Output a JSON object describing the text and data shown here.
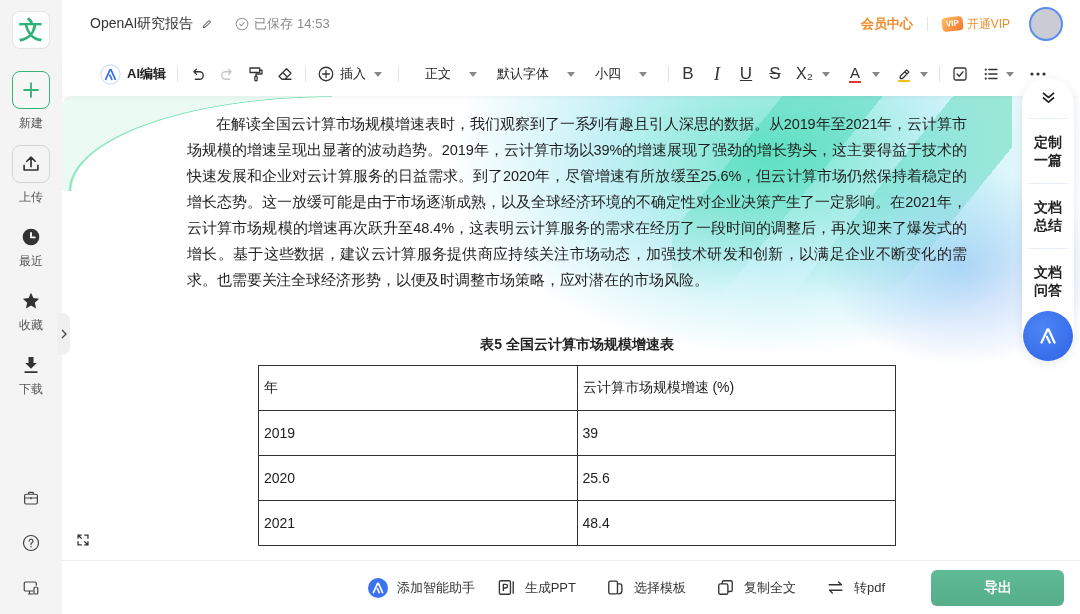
{
  "sidebar": {
    "logo": "文",
    "items": [
      {
        "label": "新建",
        "kind": "primary"
      },
      {
        "label": "上传",
        "kind": "tile"
      },
      {
        "label": "最近",
        "kind": "plain"
      },
      {
        "label": "收藏",
        "kind": "plain"
      },
      {
        "label": "下载",
        "kind": "plain"
      }
    ]
  },
  "header": {
    "title": "OpenAI研究报告",
    "save_status": "已保存 14:53",
    "member_center": "会员中心",
    "vip_badge": "VIP",
    "vip_label": "开通VIP"
  },
  "toolbar": {
    "ai_edit": "AI编辑",
    "history": [
      {
        "disabled": false
      },
      {
        "disabled": true
      }
    ],
    "insert": "插入",
    "dropdowns": [
      "正文",
      "默认字体",
      "小四"
    ],
    "formats": [
      {
        "label": "B",
        "kind": "bold"
      },
      {
        "label": "I",
        "kind": "italic"
      },
      {
        "label": "U",
        "kind": "underline"
      },
      {
        "label": "S",
        "kind": "strike"
      },
      {
        "label": "X₂",
        "kind": "subscript"
      }
    ],
    "font_color": "A"
  },
  "document": {
    "paragraph": "在解读全国云计算市场规模增速表时，我们观察到了一系列有趣且引人深思的数据。从2019年至2021年，云计算市场规模的增速呈现出显著的波动趋势。2019年，云计算市场以39%的增速展现了强劲的增长势头，这主要得益于技术的快速发展和企业对云计算服务的日益需求。到了2020年，尽管增速有所放缓至25.6%，但云计算市场仍然保持着稳定的增长态势。这一放缓可能是由于市场逐渐成熟，以及全球经济环境的不确定性对企业决策产生了一定影响。在2021年，云计算市场规模的增速再次跃升至48.4%，这表明云计算服务的需求在经历了一段时间的调整后，再次迎来了爆发式的增长。基于这些数据，建议云计算服务提供商应持续关注市场动态，加强技术研发和创新，以满足企业不断变化的需求。也需要关注全球经济形势，以便及时调整市场策略，应对潜在的市场风险。",
    "table": {
      "caption": "表5 全国云计算市场规模增速表",
      "columns": [
        "年",
        "云计算市场规模增速 (%)"
      ],
      "rows": [
        [
          "2019",
          "39"
        ],
        [
          "2020",
          "25.6"
        ],
        [
          "2021",
          "48.4"
        ]
      ]
    }
  },
  "side_panel": {
    "actions": [
      "定制一篇",
      "文档总结",
      "文档问答"
    ]
  },
  "bottom_bar": {
    "actions": [
      "添加智能助手",
      "生成PPT",
      "选择模板",
      "复制全文",
      "转pdf"
    ],
    "export": "导出"
  }
}
